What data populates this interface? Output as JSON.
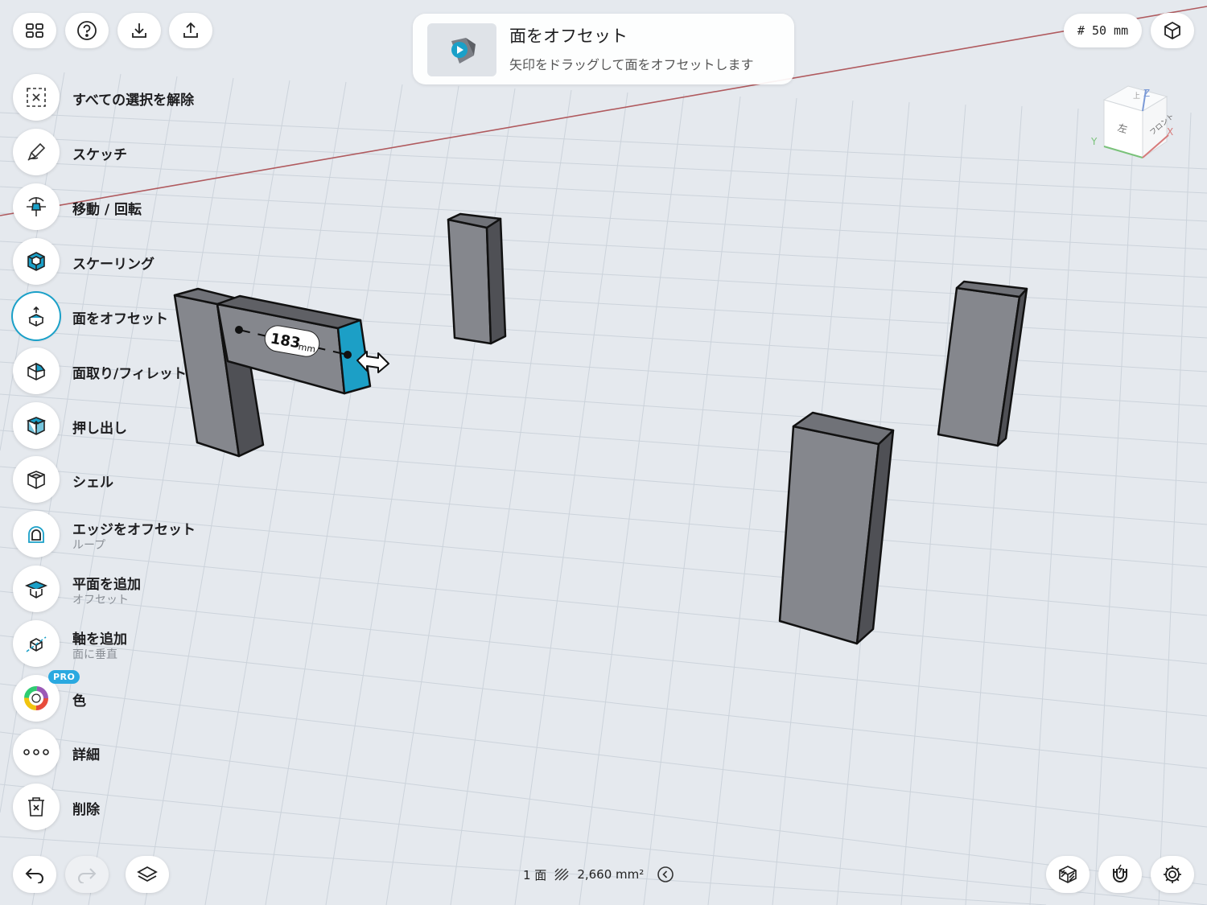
{
  "top": {
    "grid_size": "# 50 mm"
  },
  "hint": {
    "title": "面をオフセット",
    "subtitle": "矢印をドラッグして面をオフセットします"
  },
  "tools": [
    {
      "label": "すべての選択を解除",
      "icon": "deselect-icon"
    },
    {
      "label": "スケッチ",
      "icon": "pencil-icon"
    },
    {
      "label": "移動 / 回転",
      "icon": "move-rotate-icon"
    },
    {
      "label": "スケーリング",
      "icon": "scale-cube-icon"
    },
    {
      "label": "面をオフセット",
      "icon": "offset-face-icon"
    },
    {
      "label": "面取り/フィレット",
      "icon": "chamfer-icon"
    },
    {
      "label": "押し出し",
      "icon": "extrude-icon"
    },
    {
      "label": "シェル",
      "icon": "shell-icon"
    },
    {
      "label": "エッジをオフセット",
      "sub": "ループ",
      "icon": "edge-offset-icon"
    },
    {
      "label": "平面を追加",
      "sub": "オフセット",
      "icon": "add-plane-icon"
    },
    {
      "label": "軸を追加",
      "sub": "面に垂直",
      "icon": "add-axis-icon"
    },
    {
      "label": "色",
      "icon": "color-wheel-icon",
      "badge": "PRO"
    },
    {
      "label": "詳細",
      "icon": "more-icon"
    },
    {
      "label": "削除",
      "icon": "trash-icon"
    }
  ],
  "dimension": {
    "value": "183",
    "unit": "mm"
  },
  "viewcube": {
    "left": "左",
    "front": "フロント",
    "top": "上",
    "axis_x": "X",
    "axis_y": "Y",
    "axis_z": "Z"
  },
  "status": {
    "faces": "1 面",
    "area": "2,660 mm²"
  },
  "colors": {
    "accent": "#1aa0c8",
    "selected_face": "#1c9fc6",
    "solid": "#85878d",
    "solid_dark": "#4f5055"
  }
}
